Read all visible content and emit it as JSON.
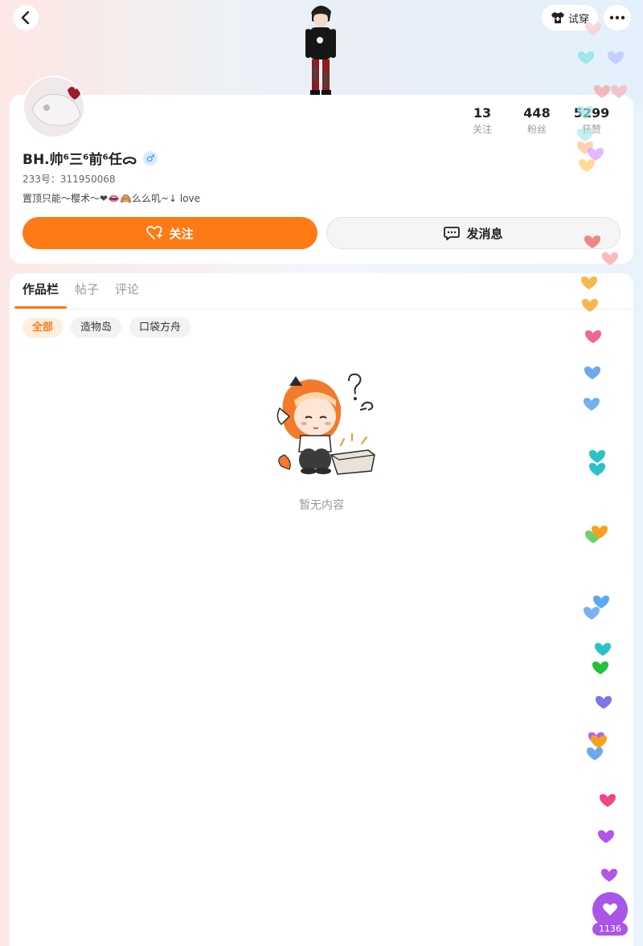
{
  "header": {
    "back_icon": "chevron-left-icon",
    "tryon_label": "试穿",
    "tryon_icon": "shirt-icon",
    "more_icon": "more-dots-icon"
  },
  "profile": {
    "username": "BH.帅⁶三⁶前⁶任ᯅ",
    "gender": "♂",
    "uid": "233号：311950068",
    "bio": "置顶只能～樱术～❤👄🙈么么叽~↓  love",
    "stats": [
      {
        "num": "13",
        "label": "关注"
      },
      {
        "num": "448",
        "label": "粉丝"
      },
      {
        "num": "5299",
        "label": "获赞"
      }
    ],
    "follow_label": "关注",
    "message_label": "发消息"
  },
  "tabs": [
    {
      "label": "作品栏",
      "active": true
    },
    {
      "label": "帖子",
      "active": false
    },
    {
      "label": "评论",
      "active": false
    }
  ],
  "filters": [
    {
      "label": "全部",
      "active": true
    },
    {
      "label": "造物岛",
      "active": false
    },
    {
      "label": "口袋方舟",
      "active": false
    }
  ],
  "empty": {
    "text": "暂无内容"
  },
  "like_button": {
    "count": "1136",
    "color": "#a855e8"
  },
  "colors": {
    "accent": "#fd7a16"
  }
}
